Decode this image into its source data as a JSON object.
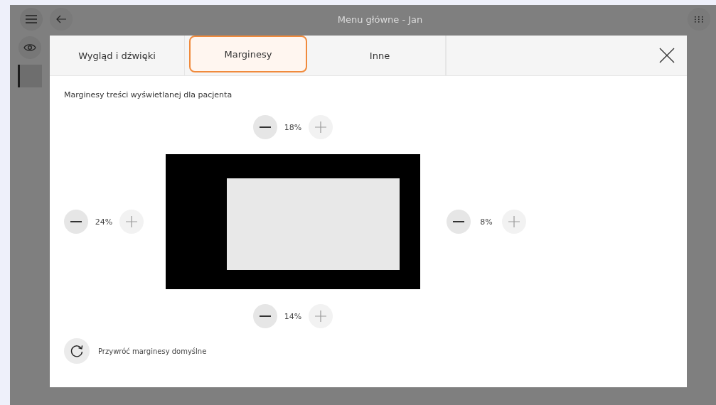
{
  "window": {
    "title": "Menu główne - Jan"
  },
  "tabs": [
    {
      "label": "Wygląd i dźwięki",
      "selected": false
    },
    {
      "label": "Marginesy",
      "selected": true
    },
    {
      "label": "Inne",
      "selected": false
    }
  ],
  "content": {
    "heading": "Marginesy treści wyświetlanej dla pacjenta"
  },
  "margins": {
    "top": {
      "reading": "18%"
    },
    "left": {
      "reading": "24%"
    },
    "right": {
      "reading": "8%"
    },
    "bottom": {
      "reading": "14%"
    }
  },
  "reset": {
    "label": "Przywróć marginesy domyślne"
  }
}
